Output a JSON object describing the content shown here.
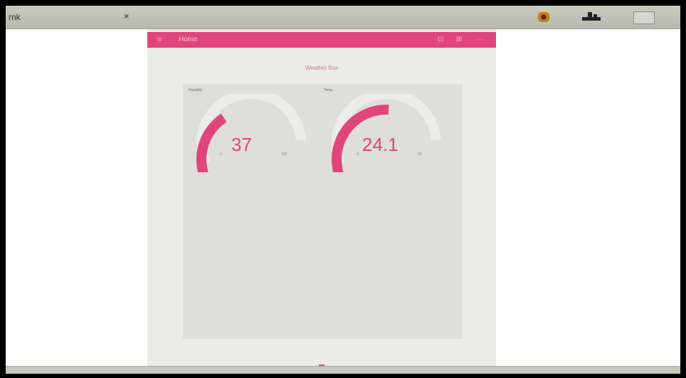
{
  "topbar": {
    "tab_title": "rnk",
    "tab_close": "×"
  },
  "app": {
    "header_menu": "≡",
    "header_title": "Home",
    "header_icons": [
      "⊡",
      "⊞",
      "⋯"
    ],
    "page_title": "Weather Box"
  },
  "gauges": [
    {
      "label": "Humidity",
      "value": "37",
      "min": "0",
      "max": "100",
      "fraction": 0.37
    },
    {
      "label": "Temp",
      "value": "24.1",
      "min": "0",
      "max": "50",
      "fraction": 0.5
    }
  ],
  "colors": {
    "accent": "#e0457b",
    "track": "#ececea",
    "panel": "#dededa"
  }
}
